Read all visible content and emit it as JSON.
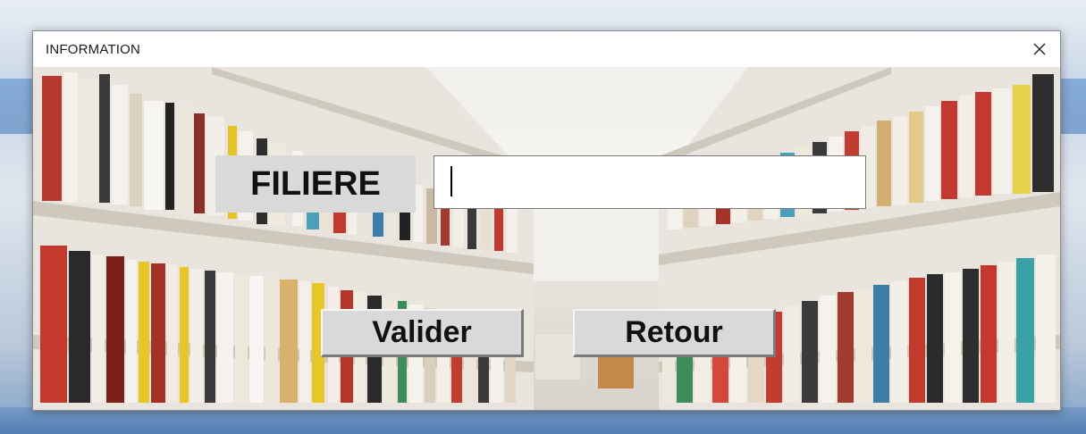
{
  "window": {
    "title": "INFORMATION",
    "close_label": "Close"
  },
  "form": {
    "filiere_label": "FILIERE",
    "filiere_value": "",
    "filiere_placeholder": ""
  },
  "buttons": {
    "valider_label": "Valider",
    "retour_label": "Retour"
  },
  "icons": {
    "close": "close-icon"
  },
  "colors": {
    "label_bg": "#d9d9d9",
    "button_bg": "#d9d9d9",
    "input_bg": "#ffffff",
    "titlebar_bg": "#ffffff"
  }
}
